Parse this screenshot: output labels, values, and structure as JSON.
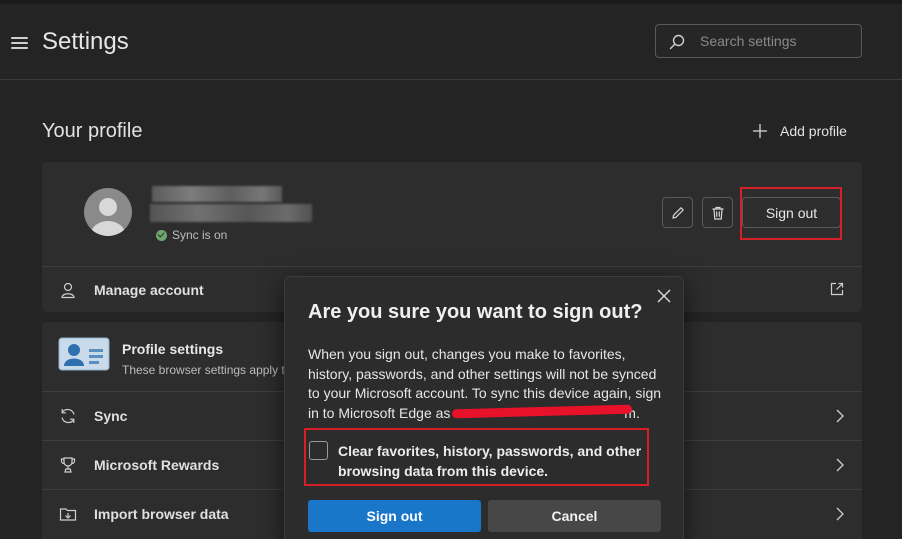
{
  "header": {
    "title": "Settings",
    "search_placeholder": "Search settings"
  },
  "profile_section": {
    "heading": "Your profile",
    "add_profile_label": "Add profile",
    "sync_status": "Sync is on",
    "sign_out_label": "Sign out",
    "rows": {
      "manage_account": "Manage account"
    }
  },
  "settings_list": {
    "profile_settings_title": "Profile settings",
    "profile_settings_desc": "These browser settings apply to",
    "items": [
      "Sync",
      "Microsoft Rewards",
      "Import browser data"
    ]
  },
  "dialog": {
    "title": "Are you sure you want to sign out?",
    "body_text": "When you sign out, changes you make to favorites, history, passwords, and other settings will not be synced to your Microsoft account. To sync this device again, sign in to Microsoft Edge as",
    "body_end": "m.",
    "checkbox_label": "Clear favorites, history, passwords, and other browsing data from this device.",
    "confirm_label": "Sign out",
    "cancel_label": "Cancel"
  },
  "colors": {
    "accent": "#1976c9",
    "highlight": "#d5202a",
    "background": "#242424",
    "card": "#2d2d2d"
  }
}
